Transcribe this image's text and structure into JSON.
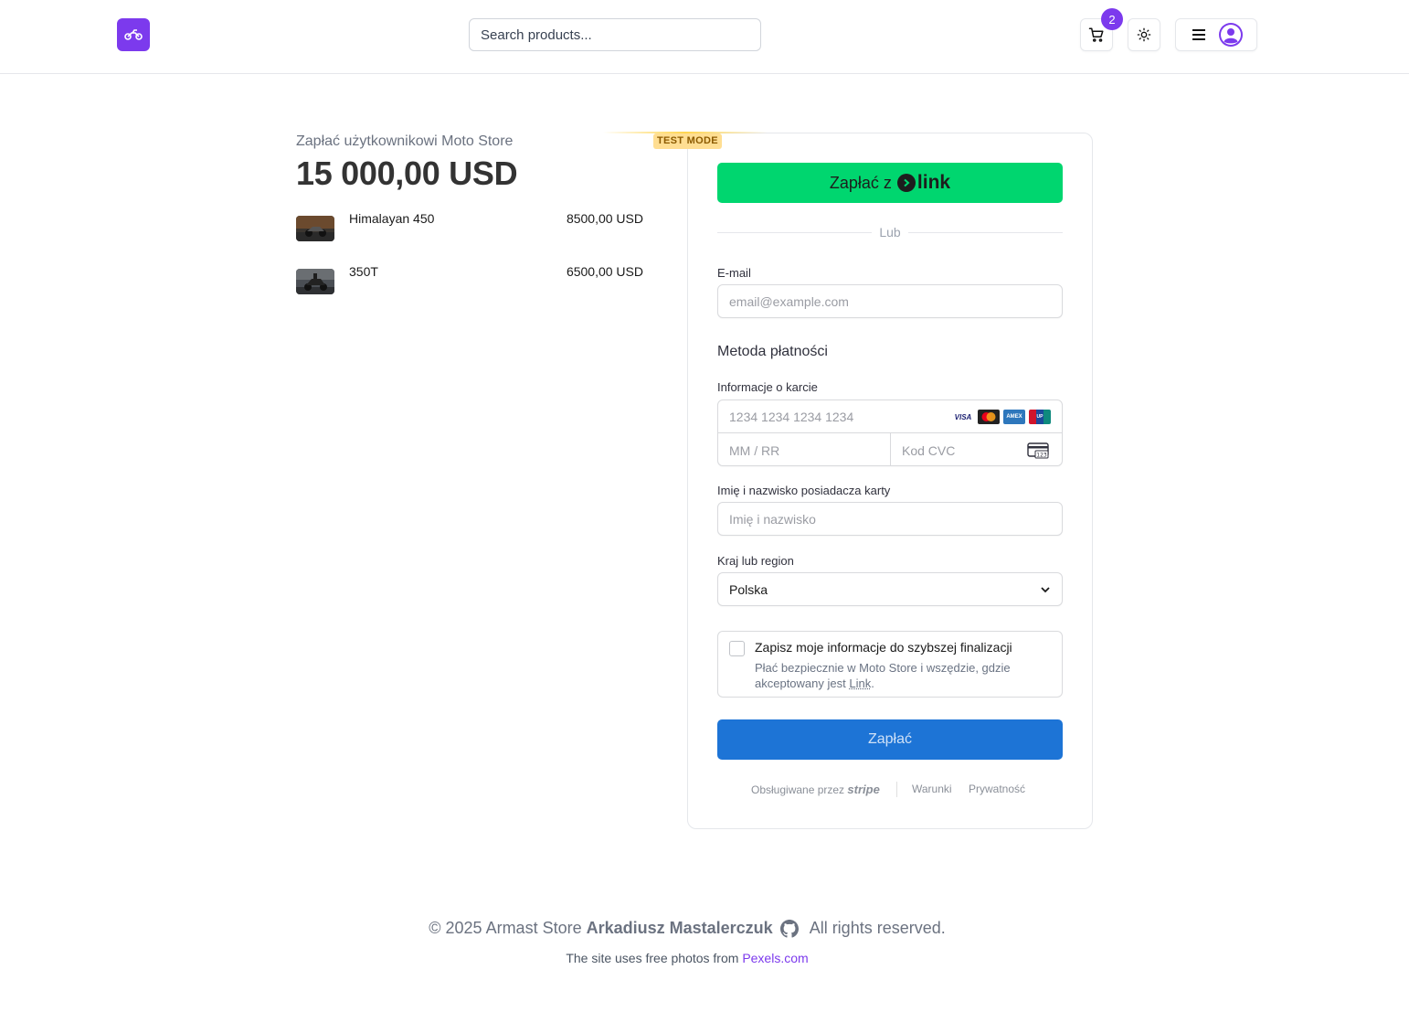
{
  "header": {
    "search_placeholder": "Search products...",
    "cart_count": "2",
    "brand_color": "#7c3aed"
  },
  "summary": {
    "pay_to": "Zapłać użytkownikowi Moto Store",
    "total": "15 000,00 USD",
    "items": [
      {
        "name": "Himalayan 450",
        "price": "8500,00 USD"
      },
      {
        "name": "350T",
        "price": "6500,00 USD"
      }
    ]
  },
  "checkout": {
    "test_mode": "TEST MODE",
    "link_button_prefix": "Zapłać z",
    "link_button_brand": "link",
    "divider": "Lub",
    "email_label": "E-mail",
    "email_placeholder": "email@example.com",
    "payment_method_title": "Metoda płatności",
    "card_info_label": "Informacje o karcie",
    "card_number_placeholder": "1234 1234 1234 1234",
    "expiry_placeholder": "MM / RR",
    "cvc_placeholder": "Kod CVC",
    "card_brands": [
      "VISA",
      "mastercard",
      "AMEX",
      "UnionPay"
    ],
    "cardholder_label": "Imię i nazwisko posiadacza karty",
    "cardholder_placeholder": "Imię i nazwisko",
    "country_label": "Kraj lub region",
    "country_value": "Polska",
    "save_title": "Zapisz moje informacje do szybszej finalizacji",
    "save_desc_prefix": "Płać bezpiecznie w Moto Store i wszędzie, gdzie akceptowany jest",
    "save_desc_link": "Link",
    "pay_button": "Zapłać",
    "powered_by": "Obsługiwane przez",
    "powered_brand": "stripe",
    "terms": "Warunki",
    "privacy": "Prywatność",
    "link_green": "#00d66f",
    "pay_blue": "#1d74d6"
  },
  "footer": {
    "copyright": "© 2025 Armast Store",
    "author": "Arkadiusz Mastalerczuk",
    "rights": "All rights reserved.",
    "photos_text": "The site uses free photos from",
    "photos_link": "Pexels.com"
  }
}
